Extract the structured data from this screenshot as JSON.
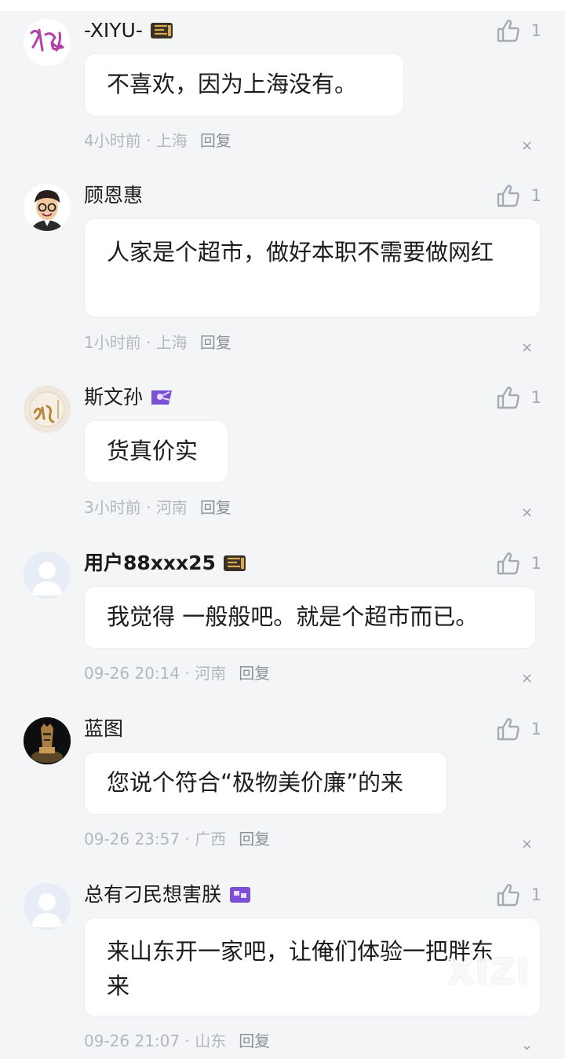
{
  "comments": [
    {
      "username": "-XIYU-",
      "badge_icon": "badge-scroll-gold-icon",
      "avatar_icon": "avatar-calligraphy-icon",
      "text": "不喜欢，因为上海没有。",
      "time": "4小时前",
      "location": "上海",
      "reply": "回复",
      "likes": "1"
    },
    {
      "username": "顾恩惠",
      "badge_icon": "",
      "avatar_icon": "avatar-cartoon-man-icon",
      "text": "人家是个超市，做好本职不需要做网红",
      "time": "1小时前",
      "location": "上海",
      "reply": "回复",
      "likes": "1"
    },
    {
      "username": "斯文孙",
      "badge_icon": "badge-purple-icon",
      "avatar_icon": "avatar-sun-character-icon",
      "text": "货真价实",
      "time": "3小时前",
      "location": "河南",
      "reply": "回复",
      "likes": "1"
    },
    {
      "username": "用户88xxx25",
      "badge_icon": "badge-scroll-gold-icon",
      "avatar_icon": "avatar-default-icon",
      "text": "我觉得 一般般吧。就是个超市而已。",
      "time": "09-26 20:14",
      "location": "河南",
      "reply": "回复",
      "likes": "1"
    },
    {
      "username": "蓝图",
      "badge_icon": "",
      "avatar_icon": "avatar-statue-icon",
      "text": "您说个符合“极物美价廉”的来",
      "time": "09-26 23:57",
      "location": "广西",
      "reply": "回复",
      "likes": "1"
    },
    {
      "username": "总有刁民想害朕",
      "badge_icon": "badge-purple-chat-icon",
      "avatar_icon": "avatar-default-icon",
      "text": "来山东开一家吧，让俺们体验一把胖东来",
      "time": "09-26 21:07",
      "location": "山东",
      "reply": "回复",
      "likes": "1"
    }
  ],
  "watermark": "XIZI",
  "colors": {
    "background": "#f4f5f7",
    "bubble": "#ffffff",
    "meta": "#b3b7bf",
    "accent_purple": "#7b4fd6",
    "badge_gold": "#b8862b"
  }
}
